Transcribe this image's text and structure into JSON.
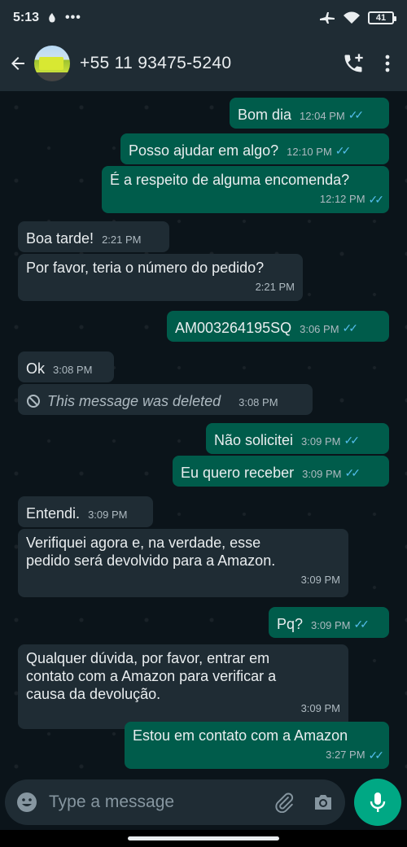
{
  "status": {
    "time": "5:13",
    "battery": "41"
  },
  "header": {
    "contact": "+55 11 93475-5240"
  },
  "messages": [
    {
      "text": "Bom dia",
      "time": "12:04 PM"
    },
    {
      "text": "Posso ajudar em algo?",
      "time": "12:10 PM"
    },
    {
      "text": "É a respeito de alguma encomenda?",
      "time": "12:12 PM"
    },
    {
      "text": "Boa tarde!",
      "time": "2:21 PM"
    },
    {
      "text": "Por favor, teria o número do pedido?",
      "time": "2:21 PM"
    },
    {
      "text": "AM003264195SQ",
      "time": "3:06 PM"
    },
    {
      "text": "Ok",
      "time": "3:08 PM"
    },
    {
      "text": "This message was deleted",
      "time": "3:08 PM"
    },
    {
      "text": "Não solicitei",
      "time": "3:09 PM"
    },
    {
      "text": "Eu quero receber",
      "time": "3:09 PM"
    },
    {
      "text": "Entendi.",
      "time": "3:09 PM"
    },
    {
      "line1": "Verifiquei agora e, na verdade, esse",
      "line2": "pedido será devolvido para a Amazon.",
      "time": "3:09 PM"
    },
    {
      "text": "Pq?",
      "time": "3:09 PM"
    },
    {
      "line1": "Qualquer dúvida, por favor, entrar em",
      "line2": "contato com a Amazon para verificar a",
      "line3": "causa da devolução.",
      "time": "3:09 PM"
    },
    {
      "text": "Estou em contato com a Amazon",
      "time": "3:27 PM"
    }
  ],
  "composer": {
    "placeholder": "Type a message"
  },
  "colors": {
    "outgoing": "#005c4b",
    "incoming": "#1f2c34",
    "accent": "#00a884",
    "read_ticks": "#53bdeb"
  },
  "icons": [
    "back-arrow-icon",
    "add-call-icon",
    "more-vert-icon",
    "emoji-icon",
    "attach-icon",
    "camera-icon",
    "mic-icon",
    "block-icon"
  ]
}
